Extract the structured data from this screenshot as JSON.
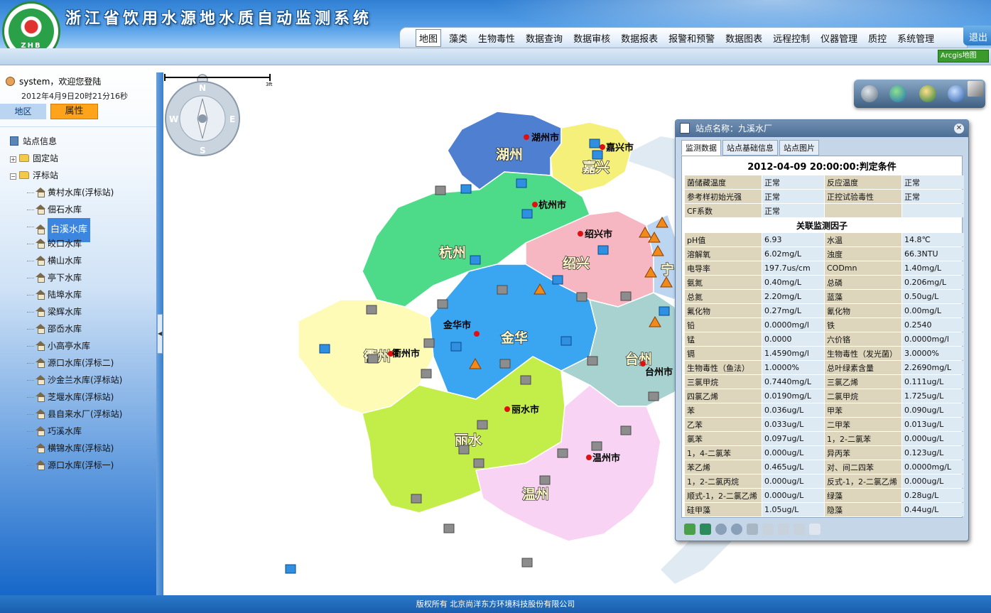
{
  "header": {
    "title": "浙江省饮用水源地水质自动监测系统",
    "logo_text": "ZHB",
    "logout_label": "退出",
    "arcgis_label": "Arcgis地图",
    "menu": [
      "地图",
      "藻类",
      "生物毒性",
      "数据查询",
      "数据审核",
      "数据报表",
      "报警和预警",
      "数据图表",
      "远程控制",
      "仪器管理",
      "质控",
      "系统管理"
    ]
  },
  "sidebar": {
    "user_text": "system，欢迎您登陆",
    "datetime": "2012年4月9日20时21分16秒",
    "tab_area": "地区",
    "tab_property": "属性",
    "tree_root": "站点信息",
    "group_fixed": "固定站",
    "group_float": "浮标站",
    "stations": [
      "黄村水库(浮标站)",
      "佃石水库",
      "白溪水库",
      "皎口水库",
      "横山水库",
      "亭下水库",
      "陆埠水库",
      "梁辉水库",
      "邵岙水库",
      "小高亭水库",
      "源口水库(浮标二)",
      "沙金兰水库(浮标站)",
      "芝堰水库(浮标站)",
      "县自来水厂(浮标站)",
      "巧溪水库",
      "横锦水库(浮标站)",
      "源口水库(浮标一)"
    ],
    "selected_index": 2
  },
  "map": {
    "regions": [
      "湖州",
      "嘉兴",
      "杭州",
      "绍兴",
      "宁",
      "金华",
      "衢州",
      "台州",
      "丽水",
      "温州"
    ],
    "cities": [
      "湖州市",
      "嘉兴市",
      "杭州市",
      "绍兴市",
      "金华市",
      "衢州市",
      "台州市",
      "丽水市",
      "温州市"
    ],
    "compass": {
      "n": "N",
      "s": "S",
      "e": "E",
      "w": "W"
    },
    "scale_label": "3ft"
  },
  "panel": {
    "title": "站点名称：九溪水厂",
    "tabs": [
      "监测数据",
      "站点基础信息",
      "站点图片"
    ],
    "heading": "2012-04-09 20:00:00:判定条件",
    "status_rows": [
      [
        "菌储藏温度",
        "正常",
        "反应温度",
        "正常"
      ],
      [
        "参考样初始光强",
        "正常",
        "正控试验毒性",
        "正常"
      ],
      [
        "CF系数",
        "正常",
        "",
        ""
      ]
    ],
    "factor_heading": "关联监测因子",
    "factor_rows": [
      [
        "pH值",
        "6.93",
        "水温",
        "14.8℃"
      ],
      [
        "溶解氧",
        "6.02mg/L",
        "浊度",
        "66.3NTU"
      ],
      [
        "电导率",
        "197.7us/cm",
        "CODmn",
        "1.40mg/L"
      ],
      [
        "氨氮",
        "0.40mg/L",
        "总磷",
        "0.206mg/L"
      ],
      [
        "总氮",
        "2.20mg/L",
        "蓝藻",
        "0.50ug/L"
      ],
      [
        "氟化物",
        "0.27mg/L",
        "氰化物",
        "0.00mg/L"
      ],
      [
        "铅",
        "0.0000mg/l",
        "铁",
        "0.2540"
      ],
      [
        "锰",
        "0.0000",
        "六价铬",
        "0.0000mg/l"
      ],
      [
        "镉",
        "1.4590mg/l",
        "生物毒性（发光菌）",
        "3.0000%"
      ],
      [
        "生物毒性（鱼法）",
        "1.0000%",
        "总叶绿素含量",
        "2.2690mg/L"
      ],
      [
        "三氯甲烷",
        "0.7440mg/L",
        "三氯乙烯",
        "0.111ug/L"
      ],
      [
        "四氯乙烯",
        "0.0190mg/L",
        "二氯甲烷",
        "1.725ug/L"
      ],
      [
        "苯",
        "0.036ug/L",
        "甲苯",
        "0.090ug/L"
      ],
      [
        "乙苯",
        "0.033ug/L",
        "二甲苯",
        "0.013ug/L"
      ],
      [
        "氯苯",
        "0.097ug/L",
        "1，2-二氯苯",
        "0.000ug/L"
      ],
      [
        "1，4-二氯苯",
        "0.000ug/L",
        "异丙苯",
        "0.123ug/L"
      ],
      [
        "苯乙烯",
        "0.465ug/L",
        "对、间二四苯",
        "0.0000mg/L"
      ],
      [
        "1，2-二氯丙烷",
        "0.000ug/L",
        "反式-1，2-二氯乙烯",
        "0.000ug/L"
      ],
      [
        "顺式-1，2-二氯乙烯",
        "0.000ug/L",
        "绿藻",
        "0.28ug/L"
      ],
      [
        "硅甲藻",
        "1.05ug/L",
        "隐藻",
        "0.44ug/L"
      ]
    ]
  },
  "footer": {
    "copyright": "版权所有 北京尚洋东方环境科技股份有限公司"
  }
}
